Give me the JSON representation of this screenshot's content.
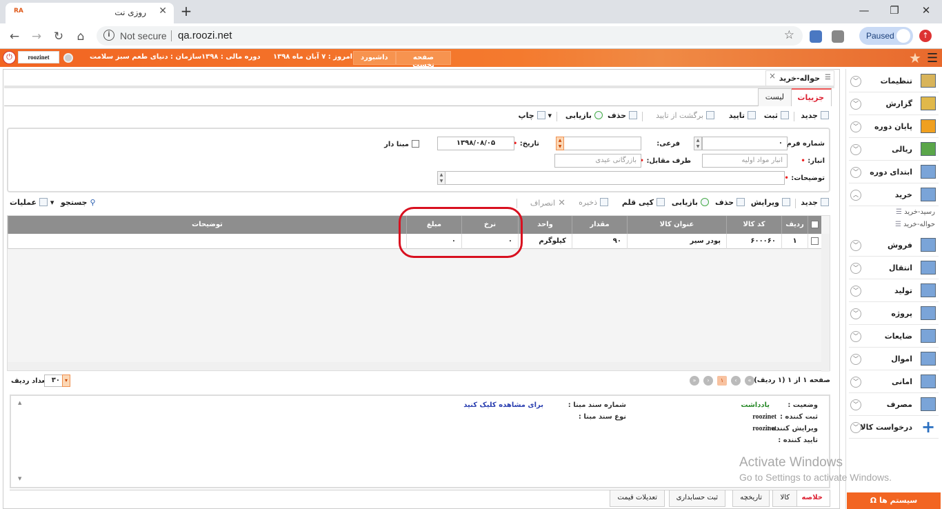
{
  "browser": {
    "tab_title": "روزی نت",
    "favicon_text": "RA",
    "not_secure": "Not secure",
    "url": "qa.roozi.net",
    "paused_label": "Paused"
  },
  "appbar": {
    "user": "roozinet",
    "org_label": "سازمان : دنیای طعم سبز سلامت",
    "fiscal_label": "دوره مالی : ۱۳۹۸",
    "today_label": "امروز : ۷ آبان ماه ۱۳۹۸",
    "dashboard": "داشبورد",
    "home": "صفحه نخست"
  },
  "sidebar": {
    "items": [
      {
        "label": "تنظیمات",
        "icon": "settings-folder-icon"
      },
      {
        "label": "گزارش",
        "icon": "report-clipboard-icon"
      },
      {
        "label": "پایان دوره",
        "icon": "period-end-icon"
      },
      {
        "label": "ریالی",
        "icon": "currency-coins-icon"
      },
      {
        "label": "ابتدای دوره",
        "icon": "grid-icon"
      },
      {
        "label": "خرید",
        "icon": "grid-icon"
      },
      {
        "label": "فروش",
        "icon": "grid-icon"
      },
      {
        "label": "انتقال",
        "icon": "grid-icon"
      },
      {
        "label": "تولید",
        "icon": "grid-icon"
      },
      {
        "label": "پروژه",
        "icon": "grid-icon"
      },
      {
        "label": "ضایعات",
        "icon": "grid-icon"
      },
      {
        "label": "اموال",
        "icon": "grid-icon"
      },
      {
        "label": "امانی",
        "icon": "grid-icon"
      },
      {
        "label": "مصرف",
        "icon": "grid-icon"
      },
      {
        "label": "درخواست کالا",
        "icon": "plus-icon"
      }
    ],
    "sub_items": [
      "رسید-خرید",
      "حواله-خرید"
    ],
    "system_button": "سیستم ها"
  },
  "page": {
    "tab_title": "حواله-خرید",
    "view_tabs": [
      "جزییات",
      "لیست"
    ]
  },
  "toolbar": {
    "new": "جدید",
    "save": "ثبت",
    "approve": "تایید",
    "unapprove": "برگشت از تایید",
    "delete": "حذف",
    "refresh": "بازیابی",
    "print": "چاپ"
  },
  "form": {
    "form_number_label": "شماره فرم:",
    "form_number": "۰",
    "sub_label": "فرعی:",
    "sub_value": "",
    "date_label": "تاریخ:",
    "date_value": "۱۳۹۸/۰۸/۰۵",
    "has_base_label": "مبنا دار",
    "warehouse_label": "انبار:",
    "warehouse_value": "انبار مواد اولیه",
    "counterparty_label": "طرف مقابل:",
    "counterparty_value": "بازرگانی عیدی",
    "description_label": "توضیحات:",
    "description_value": ""
  },
  "grid_toolbar": {
    "new": "جدید",
    "edit": "ویرایش",
    "delete": "حذف",
    "refresh": "بازیابی",
    "copy_row": "کپی قلم",
    "save": "ذخیره",
    "cancel": "انصراف",
    "search": "جستجو",
    "operations": "عملیات"
  },
  "grid": {
    "columns": [
      "ردیف",
      "کد کالا",
      "عنوان کالا",
      "مقدار",
      "واحد",
      "نرخ",
      "مبلغ",
      "توضیحات"
    ],
    "rows": [
      {
        "row": "۱",
        "code": "۶۰۰۰۶۰",
        "title": "پودر سیر",
        "qty": "۹۰",
        "unit": "کیلوگرم",
        "rate": "۰",
        "amount": "۰",
        "desc": ""
      }
    ]
  },
  "pager": {
    "page_info": "صفحه ۱ از ۱ (۱ ردیف)",
    "current_page": "۱",
    "rows_label": "تعداد ردیف",
    "rows_value": "۳۰"
  },
  "summary": {
    "status_label": "وضعیت :",
    "status_value": "یادداشت",
    "created_by_label": "ثبت کننده :",
    "created_by": "roozinet",
    "edited_by_label": "ویرایش کننده :",
    "edited_by": "roozinet",
    "approved_by_label": "تایید کننده :",
    "base_doc_num_label": "شماره سند مبنا :",
    "base_doc_type_label": "نوع سند مبنا :",
    "view_link": "برای مشاهده کلیک کنید"
  },
  "bottom_tabs": [
    "خلاصه",
    "کالا",
    "تاریخچه",
    "ثبت حسابداری",
    "تعدیلات قیمت"
  ],
  "watermark": {
    "line1": "Activate Windows",
    "line2": "Go to Settings to activate Windows."
  }
}
